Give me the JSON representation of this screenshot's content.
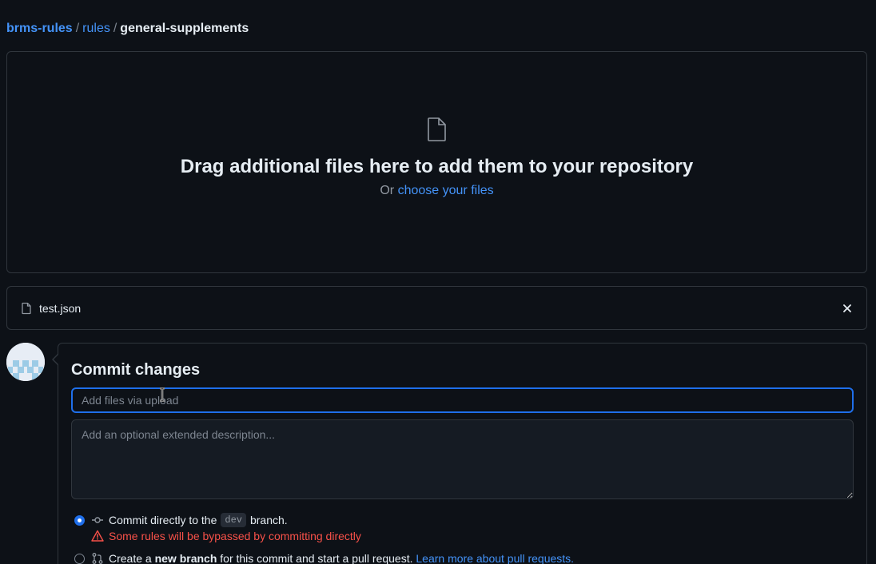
{
  "breadcrumb": {
    "repo": "brms-rules",
    "sep1": "/",
    "dir": "rules",
    "sep2": "/",
    "current": "general-supplements"
  },
  "dropzone": {
    "icon": "file-icon",
    "heading": "Drag additional files here to add them to your repository",
    "or_text": "Or ",
    "choose_link": "choose your files"
  },
  "uploaded_file": {
    "icon": "file-icon",
    "name": "test.json",
    "remove_icon": "close-icon"
  },
  "commit": {
    "title": "Commit changes",
    "summary_placeholder": "Add files via upload",
    "summary_value": "",
    "description_placeholder": "Add an optional extended description...",
    "option_direct": {
      "selected": true,
      "text_before": "Commit directly to the",
      "branch": "dev",
      "text_after": "branch.",
      "icon": "git-commit-icon"
    },
    "warning": {
      "icon": "alert-icon",
      "text": "Some rules will be bypassed by committing directly"
    },
    "option_new_branch": {
      "selected": false,
      "text_prefix": "Create a",
      "bold": "new branch",
      "text_suffix": "for this commit and start a pull request.",
      "link": "Learn more about pull requests.",
      "icon": "git-pull-request-icon"
    }
  },
  "colors": {
    "background": "#0d1117",
    "border": "#30363d",
    "link": "#4493f8",
    "accent": "#1f6feb",
    "danger": "#f85149"
  }
}
